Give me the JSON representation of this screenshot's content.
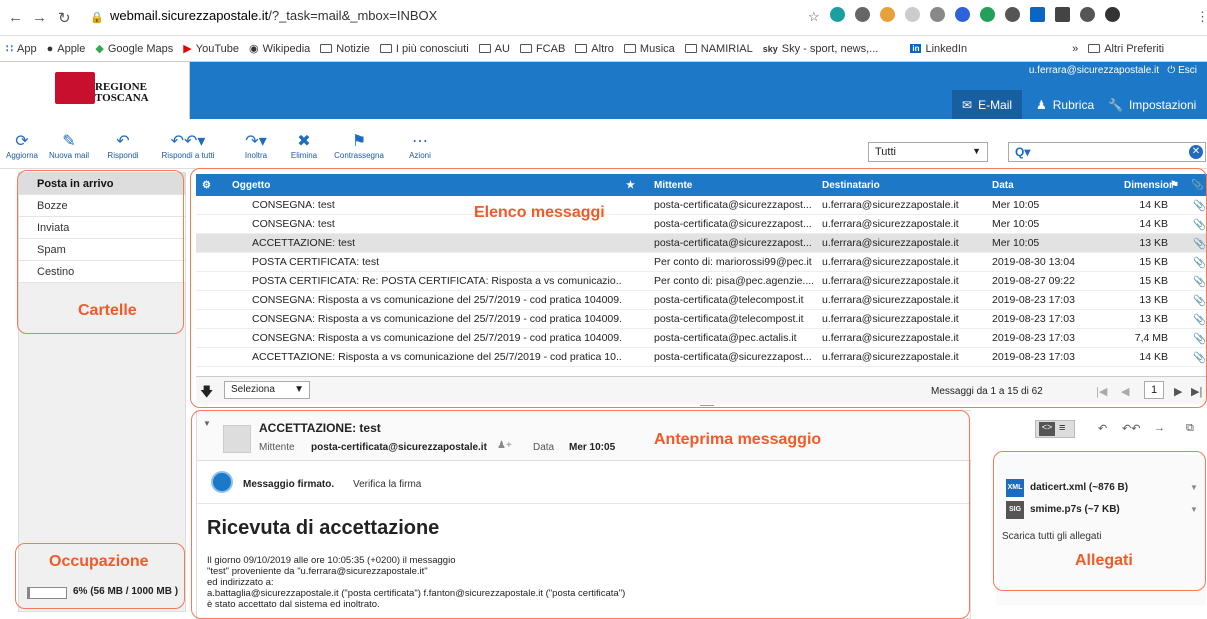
{
  "browser": {
    "url_domain": "webmail.sicurezzapostale.it",
    "url_path": "/?_task=mail&_mbox=INBOX",
    "bookmarks": [
      "App",
      "Apple",
      "Google Maps",
      "YouTube",
      "Wikipedia",
      "Notizie",
      "I più conosciuti",
      "AU",
      "FCAB",
      "Altro",
      "Musica",
      "NAMIRIAL",
      "Sky - sport, news,...",
      "LinkedIn",
      "Altri Preferiti"
    ]
  },
  "header": {
    "logo_line1": "REGIONE",
    "logo_line2": "TOSCANA",
    "user": "u.ferrara@sicurezzapostale.it",
    "logout": "Esci",
    "nav": {
      "email": "E-Mail",
      "rubrica": "Rubrica",
      "impostazioni": "Impostazioni"
    }
  },
  "toolbar": {
    "aggiorna": "Aggiorna",
    "nuova": "Nuova mail",
    "rispondi": "Rispondi",
    "rispondi_tutti": "Rispondi a tutti",
    "inoltra": "Inoltra",
    "elimina": "Elimina",
    "contrassegna": "Contrassegna",
    "azioni": "Azioni",
    "filter": "Tutti"
  },
  "folders": [
    "Posta in arrivo",
    "Bozze",
    "Inviata",
    "Spam",
    "Cestino"
  ],
  "quota": {
    "text": "6% (56 MB / 1000 MB )",
    "fraction": 0.06
  },
  "annotations": {
    "cartelle": "Cartelle",
    "elenco": "Elenco messaggi",
    "anteprima": "Anteprima messaggio",
    "occupazione": "Occupazione",
    "allegati": "Allegati"
  },
  "list": {
    "columns": {
      "oggetto": "Oggetto",
      "mittente": "Mittente",
      "destinatario": "Destinatario",
      "data": "Data",
      "dimensione": "Dimensior"
    },
    "rows": [
      {
        "subject": "CONSEGNA: test",
        "from": "posta-certificata@sicurezzapost...",
        "to": "u.ferrara@sicurezzapostale.it",
        "date": "Mer 10:05",
        "size": "14 KB"
      },
      {
        "subject": "CONSEGNA: test",
        "from": "posta-certificata@sicurezzapost...",
        "to": "u.ferrara@sicurezzapostale.it",
        "date": "Mer 10:05",
        "size": "14 KB"
      },
      {
        "subject": "ACCETTAZIONE: test",
        "from": "posta-certificata@sicurezzapost...",
        "to": "u.ferrara@sicurezzapostale.it",
        "date": "Mer 10:05",
        "size": "13 KB"
      },
      {
        "subject": "POSTA CERTIFICATA: test",
        "from": "Per conto di: mariorossi99@pec.it",
        "to": "u.ferrara@sicurezzapostale.it",
        "date": "2019-08-30 13:04",
        "size": "15 KB"
      },
      {
        "subject": "POSTA CERTIFICATA: Re: POSTA CERTIFICATA: Risposta a vs comunicazio...",
        "from": "Per conto di: pisa@pec.agenzie....",
        "to": "u.ferrara@sicurezzapostale.it",
        "date": "2019-08-27 09:22",
        "size": "15 KB"
      },
      {
        "subject": "CONSEGNA: Risposta a vs comunicazione del 25/7/2019 - cod pratica 104009...",
        "from": "posta-certificata@telecompost.it",
        "to": "u.ferrara@sicurezzapostale.it",
        "date": "2019-08-23 17:03",
        "size": "13 KB"
      },
      {
        "subject": "CONSEGNA: Risposta a vs comunicazione del 25/7/2019 - cod pratica 104009...",
        "from": "posta-certificata@telecompost.it",
        "to": "u.ferrara@sicurezzapostale.it",
        "date": "2019-08-23 17:03",
        "size": "13 KB"
      },
      {
        "subject": "CONSEGNA: Risposta a vs comunicazione del 25/7/2019 - cod pratica 104009...",
        "from": "posta-certificata@pec.actalis.it",
        "to": "u.ferrara@sicurezzapostale.it",
        "date": "2019-08-23 17:03",
        "size": "7,4 MB"
      },
      {
        "subject": "ACCETTAZIONE: Risposta a vs comunicazione del 25/7/2019 - cod pratica 10...",
        "from": "posta-certificata@sicurezzapost...",
        "to": "u.ferrara@sicurezzapostale.it",
        "date": "2019-08-23 17:03",
        "size": "14 KB"
      }
    ],
    "select_label": "Seleziona",
    "count": "Messaggi da 1 a 15 di 62",
    "page": "1"
  },
  "preview": {
    "subject": "ACCETTAZIONE: test",
    "from_label": "Mittente",
    "from": "posta-certificata@sicurezzapostale.it",
    "date_label": "Data",
    "date": "Mer 10:05",
    "signed": "Messaggio firmato.",
    "verify": "Verifica la firma",
    "title": "Ricevuta di accettazione",
    "body1": "Il giorno 09/10/2019 alle ore 10:05:35 (+0200) il messaggio",
    "body2": "\"test\" proveniente da \"u.ferrara@sicurezzapostale.it\"",
    "body3": "ed indirizzato a:",
    "body4": "a.battaglia@sicurezzapostale.it (\"posta certificata\") f.fanton@sicurezzapostale.it (\"posta certificata\")",
    "body5": "è stato accettato dal sistema ed inoltrato."
  },
  "attachments": {
    "items": [
      {
        "name": "daticert.xml (~876 B)",
        "type": "XML"
      },
      {
        "name": "smime.p7s (~7 KB)",
        "type": "SIG"
      }
    ],
    "download_all": "Scarica tutti gli allegati"
  }
}
